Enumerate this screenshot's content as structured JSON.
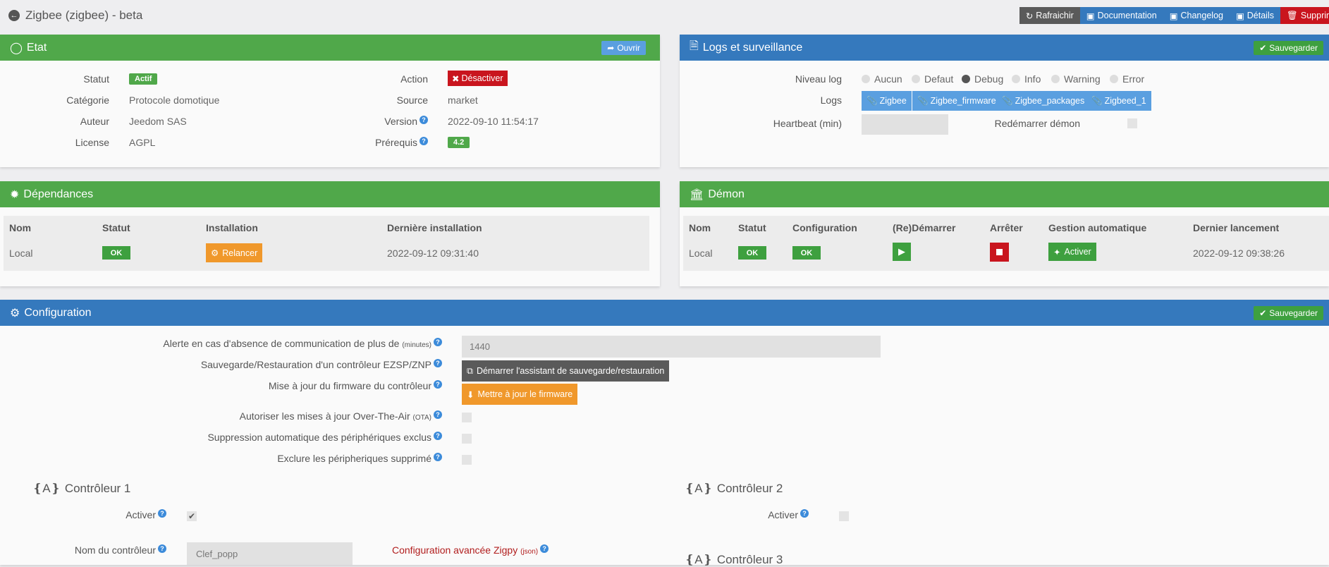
{
  "header": {
    "title": "Zigbee (zigbee) - beta",
    "buttons": [
      {
        "label": "Rafraichir",
        "icon": "refresh-icon",
        "color": "#5a5a5a"
      },
      {
        "label": "Documentation",
        "icon": "book-icon",
        "color": "#3579bd"
      },
      {
        "label": "Changelog",
        "icon": "book-icon",
        "color": "#3579bd"
      },
      {
        "label": "Détails",
        "icon": "book-icon",
        "color": "#3579bd"
      },
      {
        "label": "Supprimer",
        "icon": "trash-icon",
        "color": "#c9151e"
      }
    ]
  },
  "etat": {
    "title": "Etat",
    "open_label": "Ouvrir",
    "statut_label": "Statut",
    "statut_value": "Actif",
    "categorie_label": "Catégorie",
    "categorie_value": "Protocole domotique",
    "auteur_label": "Auteur",
    "auteur_value": "Jeedom SAS",
    "license_label": "License",
    "license_value": "AGPL",
    "action_label": "Action",
    "action_value": "Désactiver",
    "source_label": "Source",
    "source_value": "market",
    "version_label": "Version",
    "version_value": "2022-09-10 11:54:17",
    "prerequis_label": "Prérequis",
    "prerequis_value": "4.2"
  },
  "logs": {
    "title": "Logs et surveillance",
    "save_label": "Sauvegarder",
    "niveau_label": "Niveau log",
    "levels": [
      {
        "label": "Aucun",
        "selected": false
      },
      {
        "label": "Defaut",
        "selected": false
      },
      {
        "label": "Debug",
        "selected": true
      },
      {
        "label": "Info",
        "selected": false
      },
      {
        "label": "Warning",
        "selected": false
      },
      {
        "label": "Error",
        "selected": false
      }
    ],
    "logs_label": "Logs",
    "log_buttons": [
      "Zigbee",
      "Zigbee_firmware",
      "Zigbee_packages",
      "Zigbeed_1"
    ],
    "heartbeat_label": "Heartbeat (min)",
    "heartbeat_value": "",
    "restart_label": "Redémarrer démon"
  },
  "deps": {
    "title": "Dépendances",
    "headers": [
      "Nom",
      "Statut",
      "Installation",
      "Dernière installation"
    ],
    "row": {
      "nom": "Local",
      "statut": "OK",
      "install": "Relancer",
      "last": "2022-09-12 09:31:40"
    }
  },
  "demon": {
    "title": "Démon",
    "headers": [
      "Nom",
      "Statut",
      "Configuration",
      "(Re)Démarrer",
      "Arrêter",
      "Gestion automatique",
      "Dernier lancement"
    ],
    "row": {
      "nom": "Local",
      "statut": "OK",
      "config": "OK",
      "auto": "Activer",
      "last": "2022-09-12 09:38:26"
    }
  },
  "config": {
    "title": "Configuration",
    "save_label": "Sauvegarder",
    "alert_label": "Alerte en cas d'absence de communication de plus de",
    "alert_unit": "(minutes)",
    "alert_value": "1440",
    "backup_label": "Sauvegarde/Restauration d'un contrôleur EZSP/ZNP",
    "backup_button": "Démarrer l'assistant de sauvegarde/restauration",
    "fw_label": "Mise à jour du firmware du contrôleur",
    "fw_button": "Mettre à jour le firmware",
    "ota_label": "Autoriser les mises à jour Over-The-Air",
    "ota_unit": "(OTA)",
    "suppr_label": "Suppression automatique des périphériques exclus",
    "exclude_label": "Exclure les péripheriques supprimé",
    "ctrl1_title": "Contrôleur 1",
    "ctrl2_title": "Contrôleur 2",
    "ctrl3_title": "Contrôleur 3",
    "activer_label": "Activer",
    "activer2_label": "Activer",
    "nom_label": "Nom du contrôleur",
    "nom_value": "Clef_popp",
    "adv_label": "Configuration avancée Zigpy",
    "adv_unit": "(json)"
  }
}
